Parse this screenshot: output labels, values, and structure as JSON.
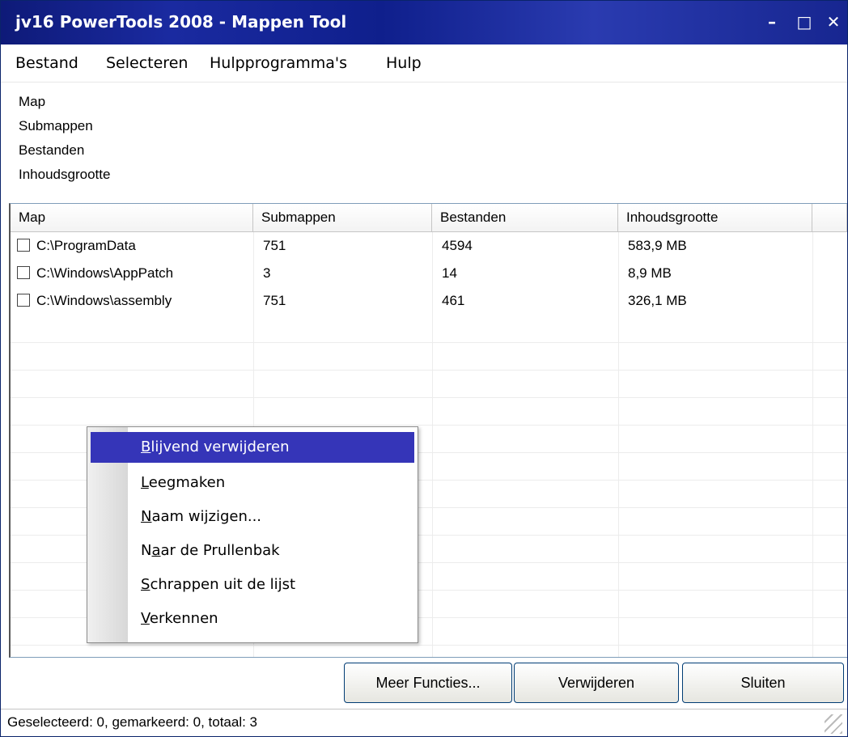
{
  "window": {
    "title": "jv16 PowerTools 2008 - Mappen Tool"
  },
  "window_controls": {
    "minimize": "–",
    "maximize": "□",
    "close": "✕"
  },
  "menu": [
    "Bestand",
    "Selecteren",
    "Hulpprogramma's",
    "Hulp"
  ],
  "info": [
    "Map",
    "Submappen",
    "Bestanden",
    "Inhoudsgrootte"
  ],
  "columns": [
    "Map",
    "Submappen",
    "Bestanden",
    "Inhoudsgrootte"
  ],
  "rows": [
    {
      "map": "C:\\ProgramData",
      "submappen": "751",
      "bestanden": "4594",
      "grootte": "583,9 MB"
    },
    {
      "map": "C:\\Windows\\AppPatch",
      "submappen": "3",
      "bestanden": "14",
      "grootte": "8,9 MB"
    },
    {
      "map": "C:\\Windows\\assembly",
      "submappen": "751",
      "bestanden": "461",
      "grootte": "326,1 MB"
    }
  ],
  "context_menu": [
    {
      "first": "B",
      "rest": "lijvend verwijderen"
    },
    {
      "first": "L",
      "rest": "eegmaken"
    },
    {
      "first": "N",
      "rest": "aam wijzigen..."
    },
    {
      "first_plain": "N",
      "underline": "a",
      "rest": "ar de Prullenbak"
    },
    {
      "first": "S",
      "rest": "chrappen uit de lijst"
    },
    {
      "first": "V",
      "rest": "erkennen"
    }
  ],
  "buttons": {
    "more": "Meer Functies...",
    "delete": "Verwijderen",
    "close": "Sluiten"
  },
  "status": {
    "text": "Geselecteerd: 0, gemarkeerd: 0, totaal: 3"
  },
  "accent_colors": {
    "titlebar": "#0e1a78",
    "selection": "#3535b8"
  }
}
